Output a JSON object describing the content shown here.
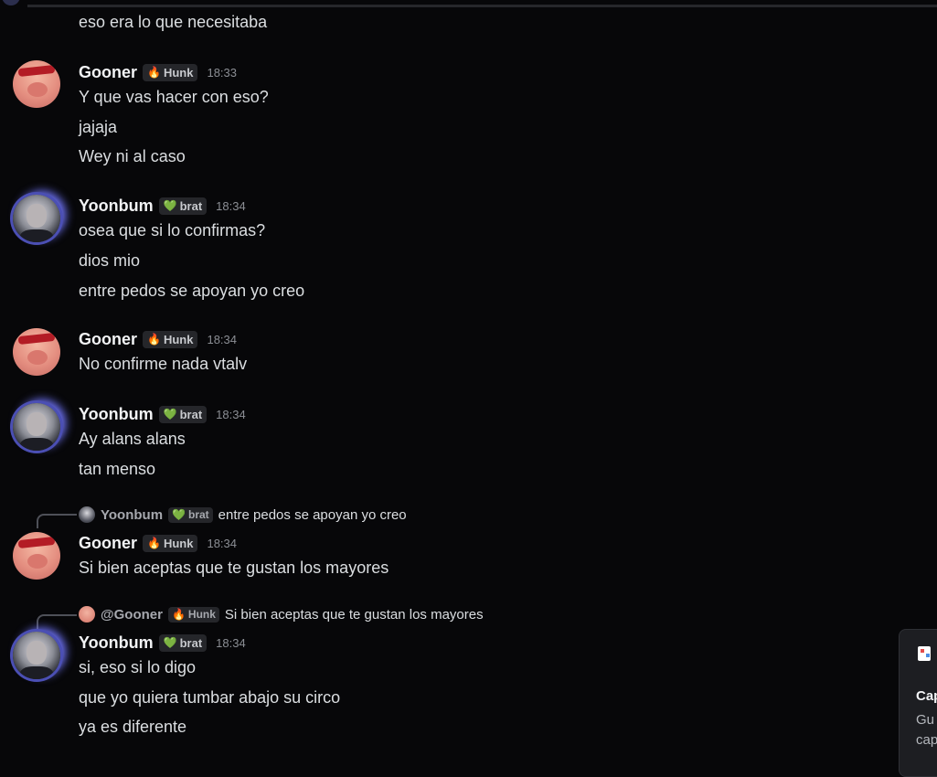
{
  "top_message": {
    "text": "eso era lo que necesitaba"
  },
  "groups": [
    {
      "author": "Gooner",
      "tag_emoji": "🔥",
      "tag": "Hunk",
      "time": "18:33",
      "lines": [
        "Y que vas hacer con eso?",
        "jajaja",
        "Wey ni al caso"
      ]
    },
    {
      "author": "Yoonbum",
      "tag_emoji": "💚",
      "tag": "brat",
      "time": "18:34",
      "lines": [
        "osea que si lo confirmas?",
        "dios mio",
        "entre pedos se apoyan yo creo"
      ]
    },
    {
      "author": "Gooner",
      "tag_emoji": "🔥",
      "tag": "Hunk",
      "time": "18:34",
      "lines": [
        "No confirme nada vtalv"
      ]
    },
    {
      "author": "Yoonbum",
      "tag_emoji": "💚",
      "tag": "brat",
      "time": "18:34",
      "lines": [
        "Ay alans alans",
        "tan menso"
      ]
    },
    {
      "reply": {
        "name": "Yoonbum",
        "tag_emoji": "💚",
        "tag": "brat",
        "text": "entre pedos se apoyan yo creo"
      },
      "author": "Gooner",
      "tag_emoji": "🔥",
      "tag": "Hunk",
      "time": "18:34",
      "lines": [
        "Si bien aceptas que te gustan los mayores"
      ]
    },
    {
      "reply": {
        "name": "@Gooner",
        "tag_emoji": "🔥",
        "tag": "Hunk",
        "text": "Si bien aceptas que te gustan los mayores"
      },
      "author": "Yoonbum",
      "tag_emoji": "💚",
      "tag": "brat",
      "time": "18:34",
      "lines": [
        "si, eso si lo digo",
        "que yo quiera tumbar abajo su circo",
        "ya es diferente"
      ]
    }
  ],
  "toast": {
    "icon": "snipping-tool-icon",
    "title": "Cap",
    "body_line1": "Gu",
    "body_line2": "cap"
  }
}
